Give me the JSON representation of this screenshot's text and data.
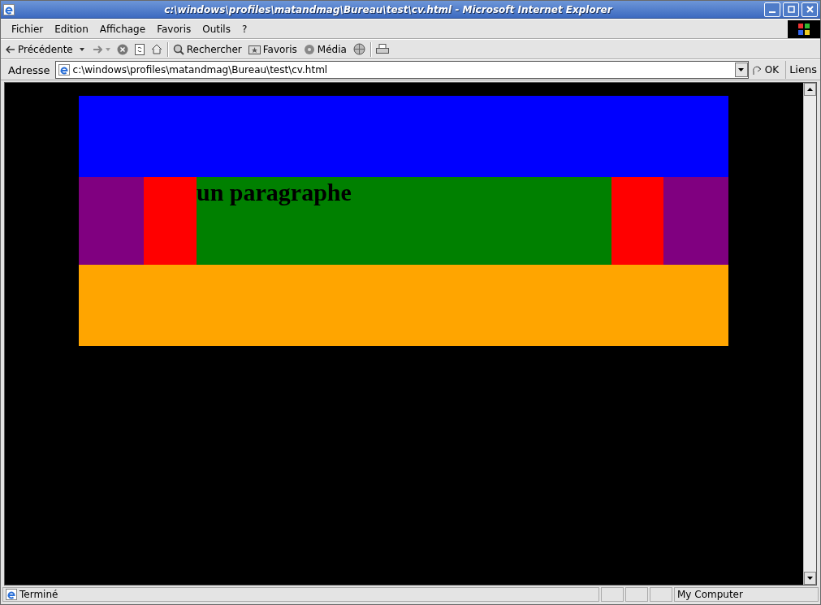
{
  "window": {
    "title": "c:\\windows\\profiles\\matandmag\\Bureau\\test\\cv.html - Microsoft Internet Explorer"
  },
  "menu": [
    "Fichier",
    "Edition",
    "Affichage",
    "Favoris",
    "Outils",
    "?"
  ],
  "toolbar": {
    "back": "Précédente",
    "search": "Rechercher",
    "favorites": "Favoris",
    "media": "Média"
  },
  "address": {
    "label": "Adresse",
    "value": "c:\\windows\\profiles\\matandmag\\Bureau\\test\\cv.html",
    "go": "OK",
    "links": "Liens"
  },
  "page": {
    "paragraph": "un paragraphe"
  },
  "status_bar": {
    "text": "Terminé",
    "zone": "My Computer"
  }
}
